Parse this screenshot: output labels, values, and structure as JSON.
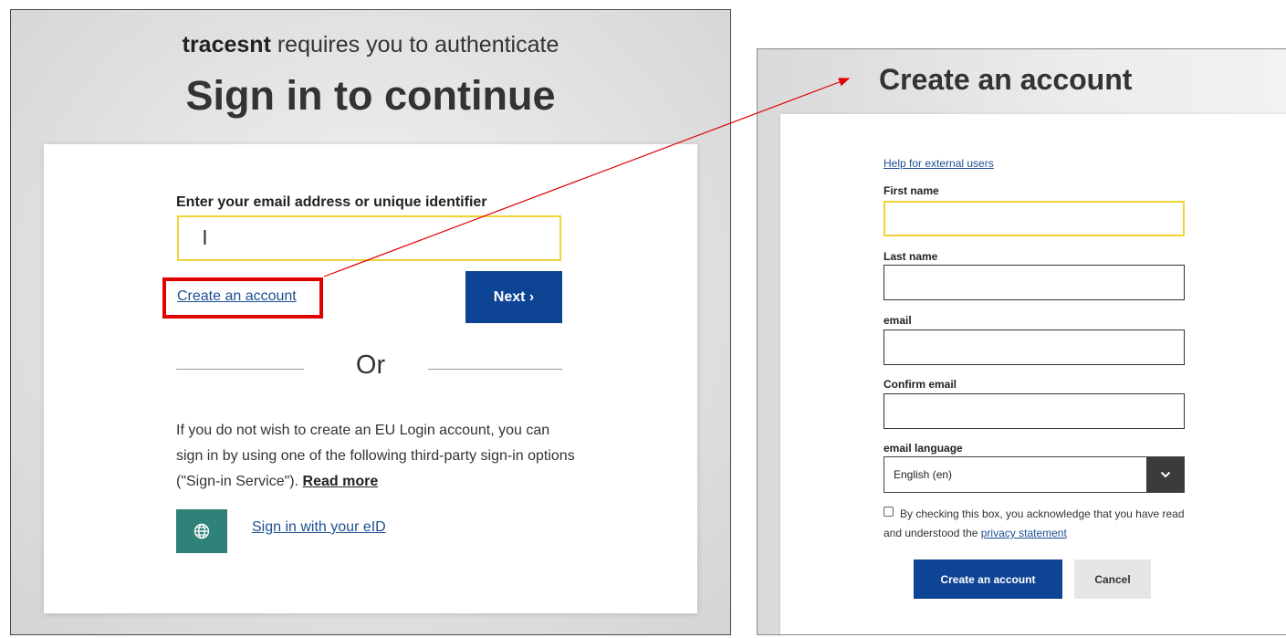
{
  "left": {
    "app_name": "tracesnt",
    "requires_text": " requires you to authenticate",
    "title": "Sign in to continue",
    "email_label": "Enter your email address or unique identifier",
    "email_value": "l",
    "create_account_link": "Create an account",
    "next_button": "Next ›",
    "or_text": "Or",
    "third_party_text": "If you do not wish to create an EU Login account, you can sign in by using one of the following third-party sign-in options (\"Sign-in Service\"). ",
    "read_more": "Read more",
    "eid_link": "Sign in with your eID",
    "eid_icon": "globe-icon"
  },
  "right": {
    "title": "Create an account",
    "help_link": "Help for external users",
    "fields": {
      "first_name_label": "First name",
      "last_name_label": "Last name",
      "email_label": "email",
      "confirm_email_label": "Confirm email",
      "language_label": "email language"
    },
    "language_value": "English (en)",
    "consent_text": "By checking this box, you acknowledge that you have read and understood the ",
    "privacy_link": "privacy statement",
    "create_button": "Create an account",
    "cancel_button": "Cancel"
  },
  "colors": {
    "primary_blue": "#0e4494",
    "highlight_red": "#e00000",
    "focus_yellow": "#f2d235",
    "eid_green": "#2e8278",
    "link_blue": "#1d4f91"
  }
}
